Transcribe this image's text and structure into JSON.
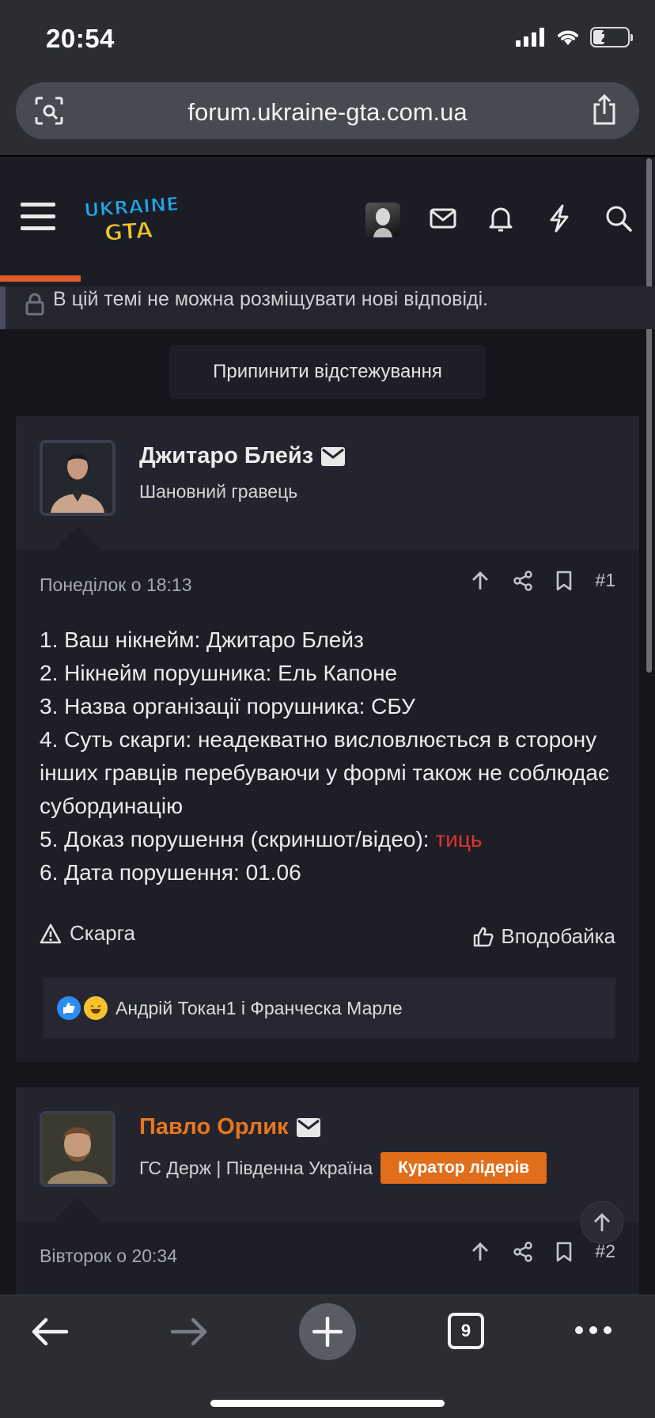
{
  "status_bar": {
    "time": "20:54",
    "battery": "28"
  },
  "browser": {
    "url": "forum.ukraine-gta.com.ua",
    "tabs_count": "9"
  },
  "site": {
    "logo_line1": "UKRAINE",
    "logo_line2": "GTA"
  },
  "thread": {
    "locked_notice": "В цій темі не можна розміщувати нові відповіді.",
    "unfollow_label": "Припинити відстежування"
  },
  "posts": [
    {
      "author": "Джитаро Блейз",
      "user_title": "Шановний гравець",
      "date": "Понеділок о 18:13",
      "number": "#1",
      "lines": [
        "1. Ваш нікнейм: Джитаро Блейз",
        "2. Нікнейм порушника: Ель Капоне",
        "3. Назва організації порушника: СБУ",
        "4. Суть скарги: неадекватно висловлюється в сторону інших гравців перебуваючи у формі також не соблюдає субординацію",
        "5. Доказ порушення (скриншот/відео): ",
        "6. Дата порушення: 01.06"
      ],
      "proof_link": "тиць",
      "report_label": "Скарга",
      "like_label": "Вподобайка",
      "reactions_text": "Андрій Токан1 і Франческа Марле"
    },
    {
      "author": "Павло Орлик",
      "user_title": "ГС Держ | Південна Україна",
      "badge": "Куратор лідерів",
      "date": "Вівторок о 20:34",
      "number": "#2"
    }
  ],
  "colors": {
    "accent_orange": "#e06e1a",
    "link_red": "#e23131",
    "bg": "#15161c"
  }
}
